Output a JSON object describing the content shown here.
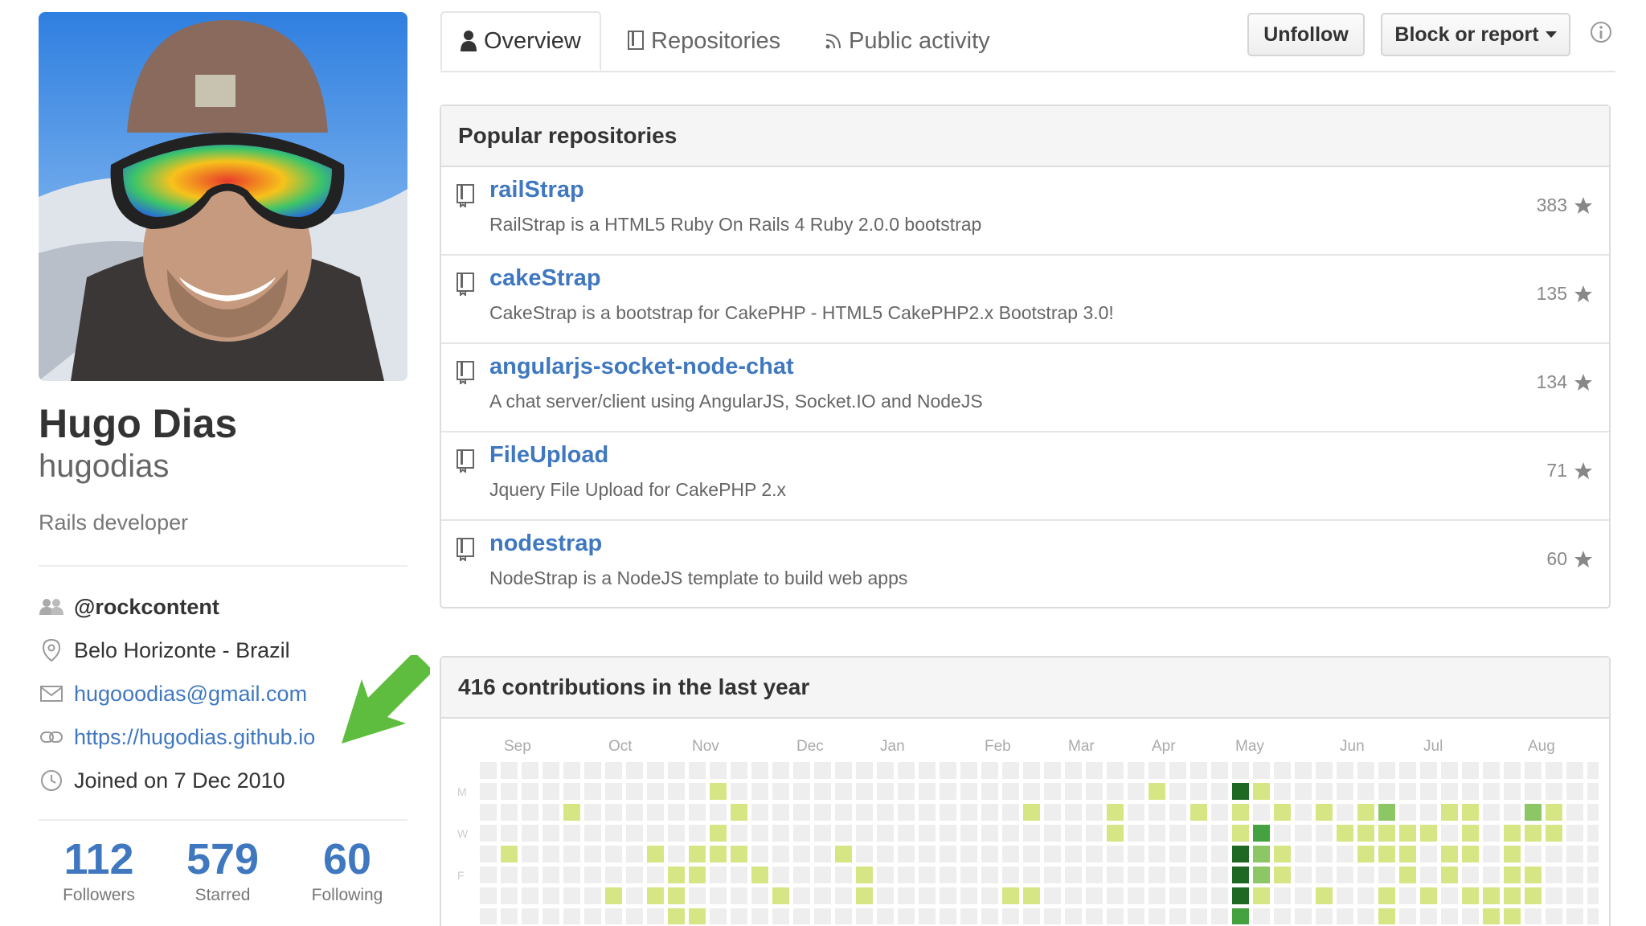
{
  "profile": {
    "full_name": "Hugo Dias",
    "username": "hugodias",
    "bio": "Rails developer",
    "organization": "@rockcontent",
    "location": "Belo Horizonte - Brazil",
    "email": "hugooodias@gmail.com",
    "website": "https://hugodias.github.io",
    "joined": "Joined on 7 Dec 2010",
    "stats": [
      {
        "value": "112",
        "label": "Followers"
      },
      {
        "value": "579",
        "label": "Starred"
      },
      {
        "value": "60",
        "label": "Following"
      }
    ]
  },
  "tabs": [
    {
      "label": "Overview",
      "icon": "person-icon"
    },
    {
      "label": "Repositories",
      "icon": "repo-book-icon"
    },
    {
      "label": "Public activity",
      "icon": "rss-icon"
    }
  ],
  "actions": {
    "unfollow_label": "Unfollow",
    "block_label": "Block or report"
  },
  "popular": {
    "title": "Popular repositories",
    "repos": [
      {
        "name": "railStrap",
        "description": "RailStrap is a HTML5 Ruby On Rails 4 Ruby 2.0.0 bootstrap",
        "stars": "383"
      },
      {
        "name": "cakeStrap",
        "description": "CakeStrap is a bootstrap for CakePHP - HTML5 CakePHP2.x Bootstrap 3.0!",
        "stars": "135"
      },
      {
        "name": "angularjs-socket-node-chat",
        "description": "A chat server/client using AngularJS, Socket.IO and NodeJS",
        "stars": "134"
      },
      {
        "name": "FileUpload",
        "description": "Jquery File Upload for CakePHP 2.x",
        "stars": "71"
      },
      {
        "name": "nodestrap",
        "description": "NodeStrap is a NodeJS template to build web apps",
        "stars": "60"
      }
    ]
  },
  "contributions": {
    "title": "416 contributions in the last year",
    "months": [
      "Sep",
      "Oct",
      "Nov",
      "Dec",
      "Jan",
      "Feb",
      "Mar",
      "Apr",
      "May",
      "Jun",
      "Jul",
      "Aug"
    ],
    "days": [
      "M",
      "W",
      "F"
    ],
    "colors": [
      "#eeeeee",
      "#d6e685",
      "#8cc665",
      "#44a340",
      "#1e6823"
    ],
    "levels": [
      [
        0,
        0,
        0,
        0,
        0,
        0,
        0,
        0,
        0,
        0,
        0,
        0,
        0,
        0,
        0,
        0,
        0,
        0,
        0,
        0,
        0,
        0,
        0,
        0,
        0,
        0,
        0,
        0,
        0,
        0,
        0,
        0,
        0,
        0,
        0,
        0,
        0,
        0,
        0,
        0,
        0,
        0,
        0,
        0,
        0,
        0,
        0,
        0,
        0,
        0,
        0,
        0,
        0,
        0
      ],
      [
        0,
        0,
        0,
        0,
        0,
        0,
        0,
        0,
        0,
        0,
        0,
        1,
        0,
        0,
        0,
        0,
        0,
        0,
        0,
        0,
        0,
        0,
        0,
        0,
        0,
        0,
        0,
        0,
        0,
        0,
        0,
        0,
        1,
        0,
        0,
        0,
        4,
        1,
        0,
        0,
        0,
        0,
        0,
        0,
        0,
        0,
        0,
        0,
        0,
        0,
        0,
        0,
        0,
        0
      ],
      [
        0,
        0,
        0,
        0,
        1,
        0,
        0,
        0,
        0,
        0,
        0,
        0,
        1,
        0,
        0,
        0,
        0,
        0,
        0,
        0,
        0,
        0,
        0,
        0,
        0,
        0,
        1,
        0,
        0,
        0,
        1,
        0,
        0,
        0,
        1,
        0,
        1,
        0,
        1,
        0,
        1,
        0,
        1,
        2,
        0,
        0,
        1,
        1,
        0,
        0,
        2,
        1,
        0,
        0
      ],
      [
        0,
        0,
        0,
        0,
        0,
        0,
        0,
        0,
        0,
        0,
        0,
        1,
        0,
        0,
        0,
        0,
        0,
        0,
        0,
        0,
        0,
        0,
        0,
        0,
        0,
        0,
        0,
        0,
        0,
        0,
        1,
        0,
        0,
        0,
        0,
        0,
        1,
        3,
        0,
        0,
        0,
        1,
        1,
        1,
        1,
        1,
        0,
        1,
        0,
        1,
        1,
        1,
        0,
        0
      ],
      [
        0,
        1,
        0,
        0,
        0,
        0,
        0,
        0,
        1,
        0,
        1,
        1,
        1,
        0,
        0,
        0,
        0,
        1,
        0,
        0,
        0,
        0,
        0,
        0,
        0,
        0,
        0,
        0,
        0,
        0,
        0,
        0,
        0,
        0,
        0,
        0,
        4,
        2,
        1,
        0,
        0,
        0,
        1,
        1,
        1,
        0,
        1,
        1,
        0,
        1,
        0,
        0,
        0,
        0
      ],
      [
        0,
        0,
        0,
        0,
        0,
        0,
        0,
        0,
        0,
        1,
        1,
        0,
        0,
        1,
        0,
        0,
        0,
        0,
        1,
        0,
        0,
        0,
        0,
        0,
        0,
        0,
        0,
        0,
        0,
        0,
        0,
        0,
        0,
        0,
        0,
        0,
        4,
        2,
        1,
        0,
        0,
        0,
        0,
        0,
        1,
        0,
        1,
        0,
        0,
        1,
        1,
        0,
        0,
        0
      ],
      [
        0,
        0,
        0,
        0,
        0,
        0,
        1,
        0,
        1,
        1,
        0,
        0,
        0,
        0,
        1,
        0,
        0,
        0,
        1,
        0,
        0,
        0,
        0,
        0,
        0,
        1,
        1,
        0,
        0,
        0,
        0,
        0,
        0,
        0,
        0,
        0,
        4,
        1,
        0,
        0,
        1,
        0,
        0,
        1,
        0,
        1,
        0,
        1,
        1,
        1,
        1,
        0,
        0,
        0
      ],
      [
        0,
        0,
        0,
        0,
        0,
        0,
        0,
        0,
        0,
        1,
        1,
        0,
        0,
        0,
        0,
        0,
        0,
        0,
        0,
        0,
        0,
        0,
        0,
        0,
        0,
        0,
        0,
        0,
        0,
        0,
        0,
        0,
        0,
        0,
        0,
        0,
        3,
        0,
        0,
        0,
        0,
        0,
        0,
        1,
        0,
        0,
        0,
        0,
        1,
        1,
        0,
        0,
        0,
        0
      ]
    ]
  }
}
